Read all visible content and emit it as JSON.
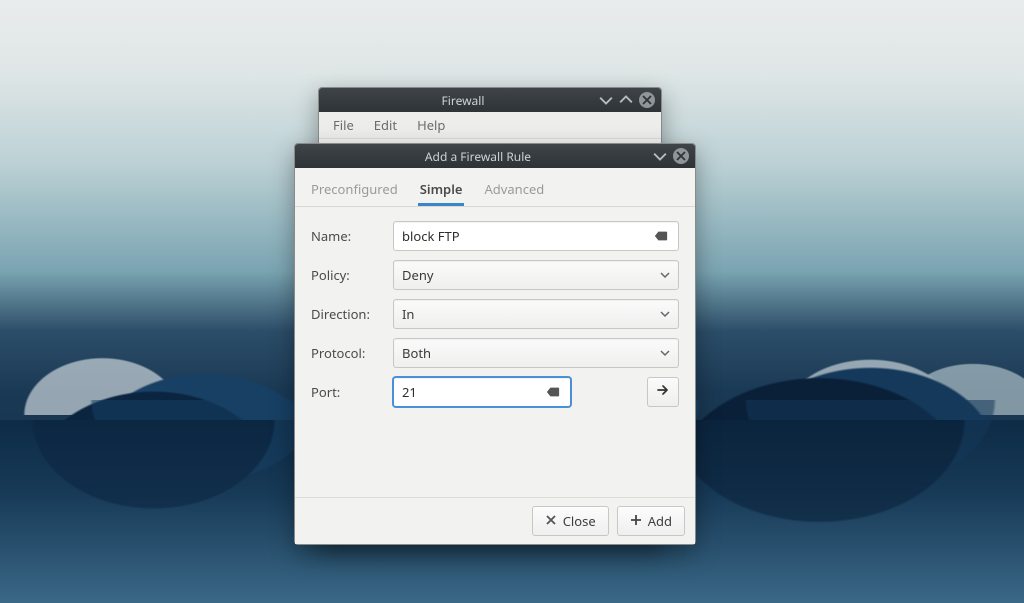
{
  "firewall_window": {
    "title": "Firewall",
    "menu": {
      "file": "File",
      "edit": "Edit",
      "help": "Help"
    }
  },
  "rule_dialog": {
    "title": "Add a Firewall Rule",
    "tabs": {
      "preconfigured": "Preconfigured",
      "simple": "Simple",
      "advanced": "Advanced"
    },
    "labels": {
      "name": "Name:",
      "policy": "Policy:",
      "direction": "Direction:",
      "protocol": "Protocol:",
      "port": "Port:"
    },
    "values": {
      "name": "block FTP",
      "policy": "Deny",
      "direction": "In",
      "protocol": "Both",
      "port": "21"
    },
    "buttons": {
      "close": "Close",
      "add": "Add"
    }
  }
}
